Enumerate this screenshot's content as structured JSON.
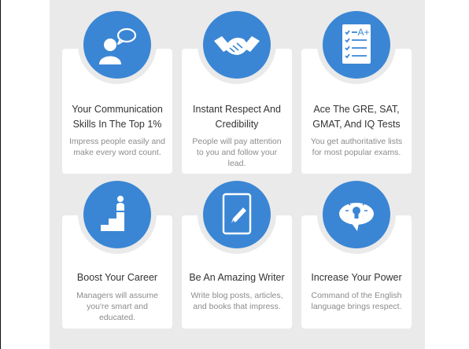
{
  "features": [
    {
      "icon": "person-speech-icon",
      "title_line1": "Your Communication",
      "title_line2": "Skills In The Top 1%",
      "desc_line1": "Impress people easily and",
      "desc_line2": "make every word count.",
      "desc_line3": ""
    },
    {
      "icon": "handshake-icon",
      "title_line1": "Instant Respect And",
      "title_line2": "Credibility",
      "desc_line1": "People will pay attention",
      "desc_line2": "to you and follow your",
      "desc_line3": "lead."
    },
    {
      "icon": "graded-checklist-icon",
      "badge_text": "A+",
      "title_line1": "Ace The GRE, SAT,",
      "title_line2": "GMAT, And IQ Tests",
      "desc_line1": "You get authoritative lists",
      "desc_line2": "for most popular exams.",
      "desc_line3": ""
    },
    {
      "icon": "career-stairs-icon",
      "title_line1": "Boost Your Career",
      "desc_line1": "Managers will assume",
      "desc_line2": "you're smart and",
      "desc_line3": "educated."
    },
    {
      "icon": "tablet-pen-icon",
      "title_line1": "Be An Amazing Writer",
      "desc_line1": "Write blog posts, articles,",
      "desc_line2": "and books that impress.",
      "desc_line3": ""
    },
    {
      "icon": "lightbulb-idea-icon",
      "title_line1": "Increase Your Power",
      "desc_line1": "Command of the English",
      "desc_line2": "language brings respect.",
      "desc_line3": ""
    }
  ],
  "colors": {
    "icon_circle": "#3a86d4",
    "panel_background": "#eaeaea",
    "card_background": "#ffffff",
    "title_text": "#333333",
    "desc_text": "#8b8b8b"
  }
}
